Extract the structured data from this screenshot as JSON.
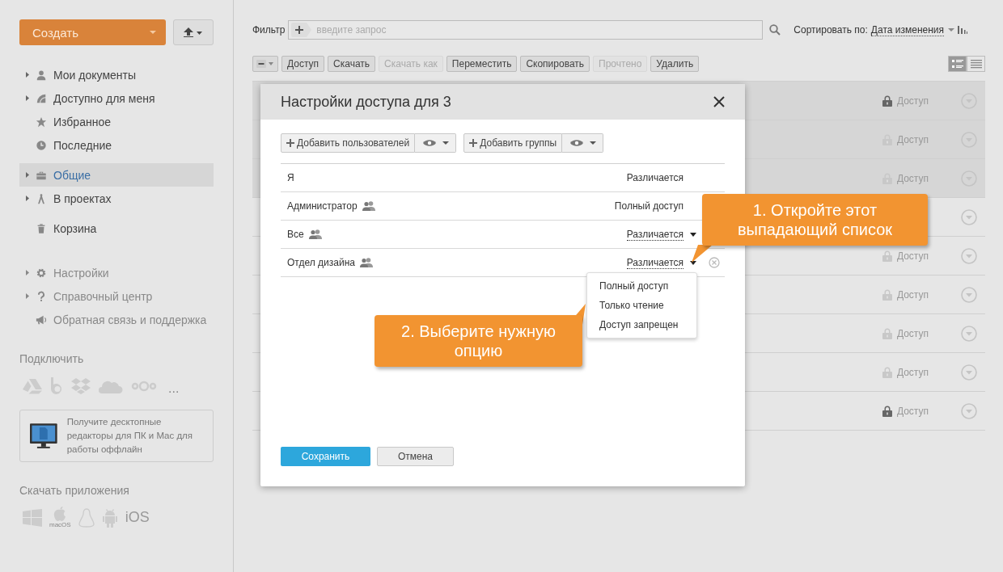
{
  "sidebar": {
    "create_button": "Создать",
    "nav_groups": [
      {
        "items": [
          {
            "label": "Мои документы",
            "expandable": true,
            "selected": false
          },
          {
            "label": "Доступно для меня",
            "expandable": true,
            "selected": false
          },
          {
            "label": "Избранное",
            "expandable": false,
            "selected": false
          },
          {
            "label": "Последние",
            "expandable": false,
            "selected": false
          }
        ]
      },
      {
        "items": [
          {
            "label": "Общие",
            "expandable": true,
            "selected": true
          },
          {
            "label": "В проектах",
            "expandable": true,
            "selected": false
          }
        ]
      },
      {
        "items": [
          {
            "label": "Корзина",
            "expandable": false,
            "selected": false
          }
        ]
      }
    ],
    "help_items": [
      {
        "label": "Настройки",
        "expandable": true
      },
      {
        "label": "Справочный центр",
        "expandable": true
      },
      {
        "label": "Обратная связь и поддержка",
        "expandable": false
      }
    ],
    "connect": {
      "title": "Подключить",
      "more": "..."
    },
    "promo": "Получите десктопные редакторы для ПК и Mac для работы оффлайн",
    "apps": {
      "title": "Скачать приложения",
      "macos_label": "macOS",
      "ios_label": "iOS"
    }
  },
  "filter": {
    "label": "Фильтр",
    "placeholder": "введите запрос",
    "sort_label": "Сортировать по:",
    "sort_value": "Дата изменения"
  },
  "toolbar": [
    {
      "label": "Доступ",
      "disabled": false
    },
    {
      "label": "Скачать",
      "disabled": false
    },
    {
      "label": "Скачать как",
      "disabled": true
    },
    {
      "label": "Переместить",
      "disabled": false
    },
    {
      "label": "Скопировать",
      "disabled": false
    },
    {
      "label": "Прочтено",
      "disabled": true
    },
    {
      "label": "Удалить",
      "disabled": false
    }
  ],
  "view_modes": [
    {
      "selected": true
    },
    {
      "selected": false
    }
  ],
  "files": [
    {
      "selected": true,
      "locked": true,
      "access": "Доступ"
    },
    {
      "selected": true,
      "locked": false,
      "access": "Доступ"
    },
    {
      "selected": true,
      "locked": false,
      "access": "Доступ"
    },
    {
      "selected": false
    },
    {
      "selected": false,
      "locked": false,
      "access": "Доступ"
    },
    {
      "selected": false,
      "locked": false,
      "access": "Доступ"
    },
    {
      "selected": false,
      "locked": false,
      "access": "Доступ"
    },
    {
      "selected": false,
      "locked": false,
      "access": "Доступ"
    },
    {
      "selected": false,
      "locked": true,
      "access": "Доступ"
    }
  ],
  "dialog": {
    "title": "Настройки доступа для 3",
    "add_users": "Добавить пользователей",
    "add_groups": "Добавить группы",
    "rows": [
      {
        "name": "Я",
        "group": false,
        "access": "Различается",
        "dropdown": false,
        "removable": false
      },
      {
        "name": "Администратор",
        "group": true,
        "access": "Полный доступ",
        "dropdown": false,
        "removable": false
      },
      {
        "name": "Все",
        "group": true,
        "access": "Различается",
        "dropdown": true,
        "removable": false
      },
      {
        "name": "Отдел дизайна",
        "group": true,
        "access": "Различается",
        "dropdown": true,
        "removable": true
      }
    ],
    "menu": [
      "Полный доступ",
      "Только чтение",
      "Доступ запрещен"
    ],
    "save": "Сохранить",
    "cancel": "Отмена"
  },
  "callouts": [
    {
      "text": "1. Откройте этот выпадающий список"
    },
    {
      "text": "2. Выберите нужную опцию"
    }
  ]
}
